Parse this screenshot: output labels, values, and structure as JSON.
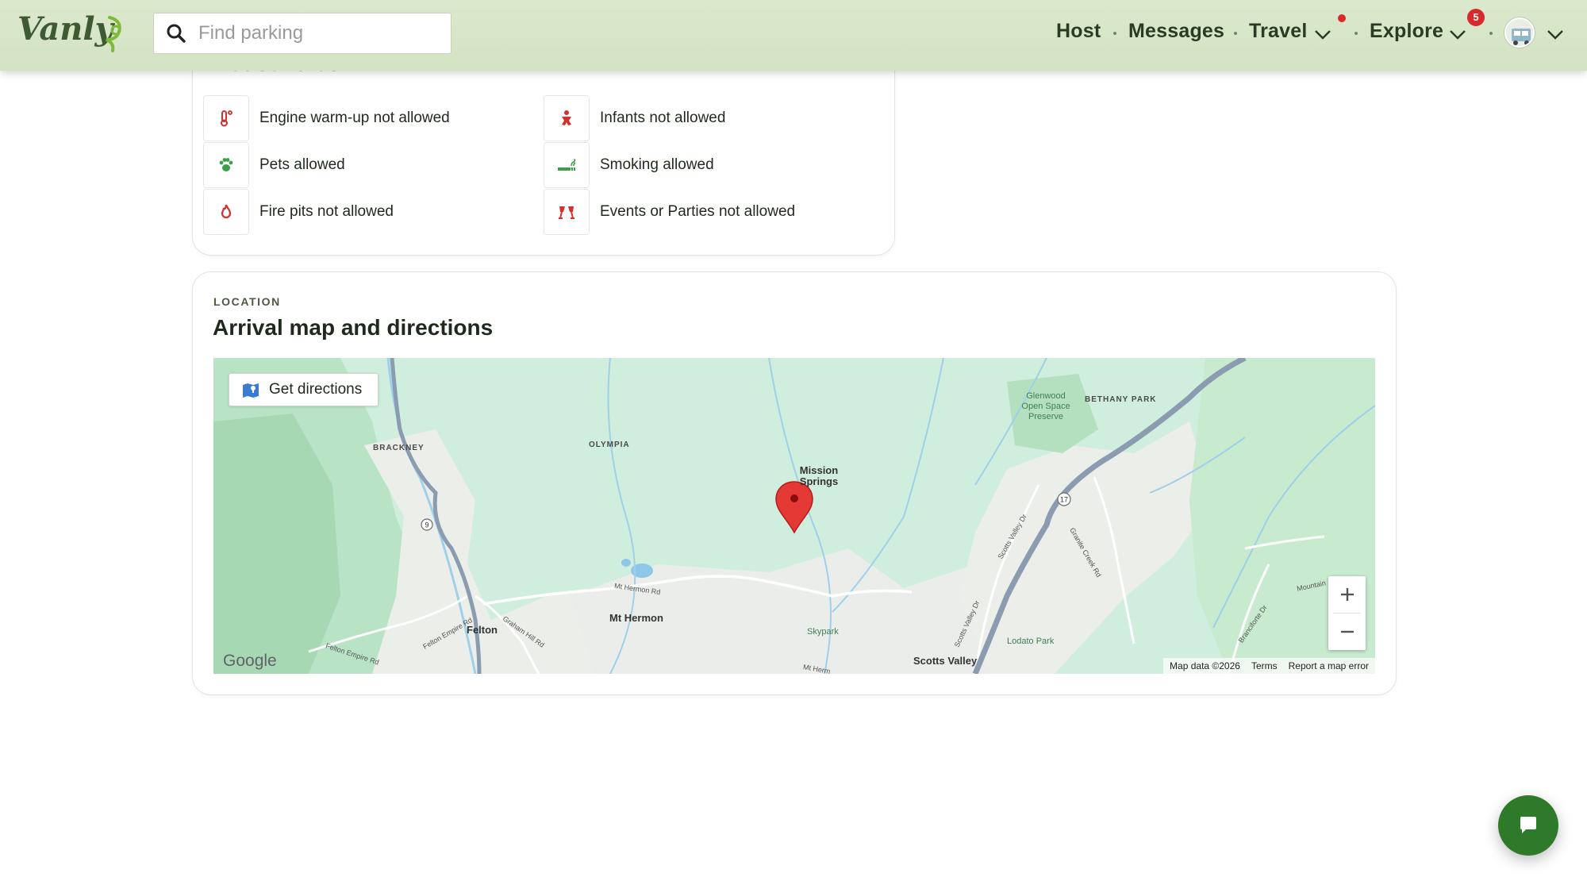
{
  "header": {
    "logo_text": "Vanly",
    "search": {
      "placeholder": "Find parking",
      "value": ""
    },
    "nav": {
      "host": "Host",
      "messages": "Messages",
      "travel": "Travel",
      "explore": "Explore",
      "explore_badge": "5"
    }
  },
  "house_rules": {
    "title": "House rules",
    "items": [
      {
        "label": "Engine warm-up not allowed",
        "icon": "thermometer-icon",
        "color": "#d3302f"
      },
      {
        "label": "Infants not allowed",
        "icon": "baby-icon",
        "color": "#d3302f"
      },
      {
        "label": "Pets allowed",
        "icon": "paw-icon",
        "color": "#3aa148"
      },
      {
        "label": "Smoking allowed",
        "icon": "smoking-icon",
        "color": "#3aa148"
      },
      {
        "label": "Fire pits not allowed",
        "icon": "fire-icon",
        "color": "#d3302f"
      },
      {
        "label": "Events or Parties not allowed",
        "icon": "party-icon",
        "color": "#d3302f"
      }
    ]
  },
  "location": {
    "eyebrow": "LOCATION",
    "title": "Arrival map and directions",
    "get_directions": "Get directions",
    "map": {
      "labels": {
        "brackney": "BRACKNEY",
        "olympia": "OLYMPIA",
        "mission_springs": "Mission Springs",
        "bethany_park": "BETHANY PARK",
        "glenwood": "Glenwood Open Space Preserve",
        "felton": "Felton",
        "mt_hermon": "Mt Hermon",
        "mt_hermon_rd": "Mt Hermon Rd",
        "felton_empire_rd_1": "Felton Empire Rd",
        "felton_empire_rd_2": "Felton Empire Rd",
        "graham_hill_rd": "Graham Hill Rd",
        "skypark": "Skypark",
        "scotts_valley": "Scotts Valley",
        "scotts_valley_dr_1": "Scotts Valley Dr",
        "scotts_valley_dr_2": "Scotts Valley Dr",
        "granite_creek_rd": "Granite Creek Rd",
        "lodato_park": "Lodato Park",
        "branciforte_dr": "Branciforte Dr",
        "mountain": "Mountain",
        "mt_herm_cut": "Mt Herm",
        "hwy_9": "9",
        "hwy_17": "17"
      },
      "google": "Google",
      "map_data": "Map data ©2026",
      "terms": "Terms",
      "report": "Report a map error",
      "zoom_in": "+",
      "zoom_out": "−"
    }
  }
}
